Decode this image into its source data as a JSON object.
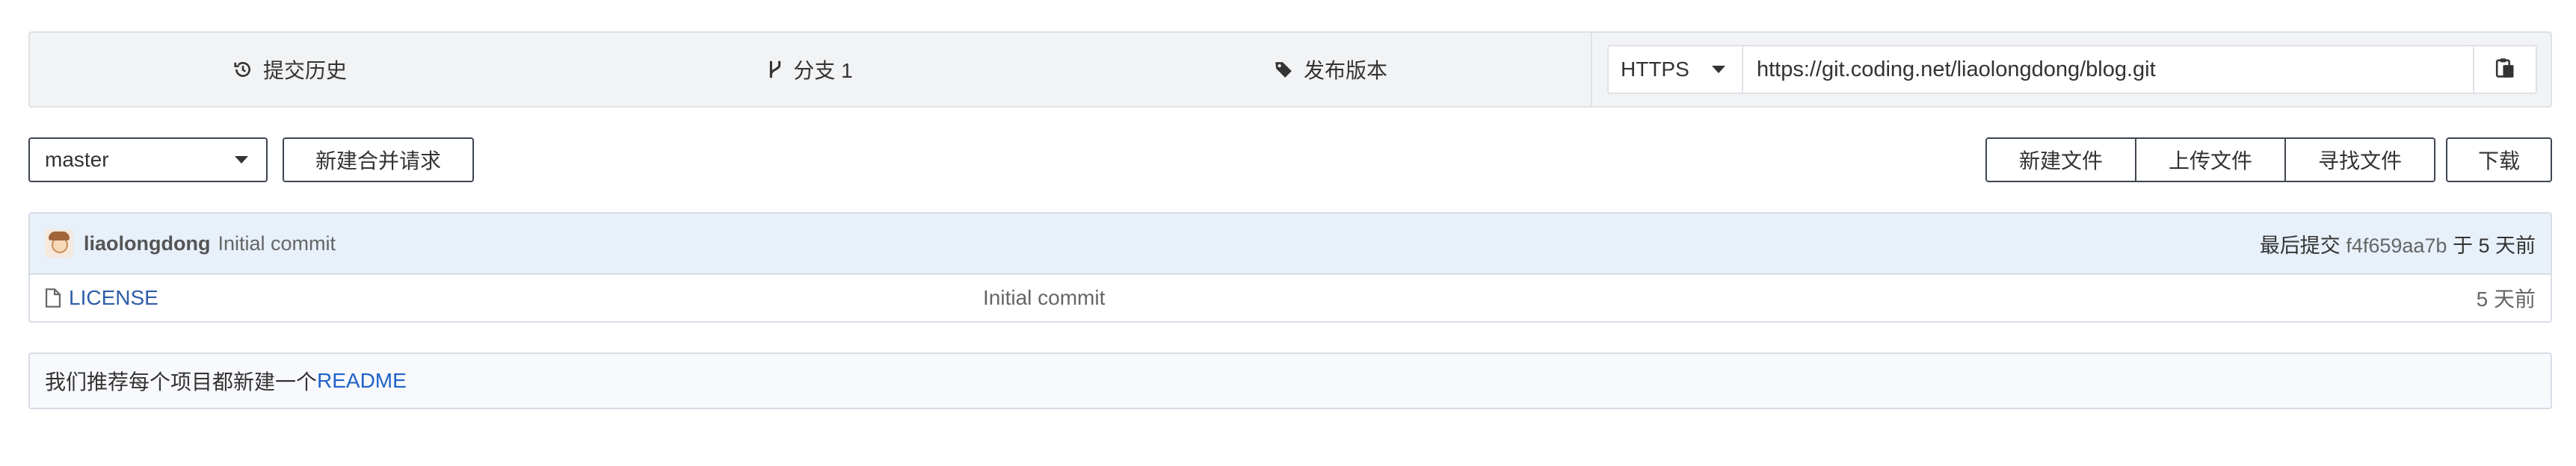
{
  "topbar": {
    "commits_label": "提交历史",
    "branches_label": "分支 1",
    "releases_label": "发布版本"
  },
  "clone": {
    "protocol": "HTTPS",
    "url": "https://git.coding.net/liaolongdong/blog.git"
  },
  "toolbar": {
    "branch": "master",
    "new_merge_request": "新建合并请求",
    "new_file": "新建文件",
    "upload_file": "上传文件",
    "find_file": "寻找文件",
    "download": "下载"
  },
  "last_commit": {
    "author": "liaolongdong",
    "message": "Initial commit",
    "prefix": "最后提交",
    "hash": "f4f659aa7b",
    "suffix": "于 5 天前"
  },
  "files": [
    {
      "name": "LICENSE",
      "message": "Initial commit",
      "time": "5 天前"
    }
  ],
  "readme_hint": {
    "text": "我们推荐每个项目都新建一个",
    "link": "README"
  },
  "colors": {
    "link": "#2f5ea8",
    "readme_link": "#1f63c9",
    "commit_row_bg": "#e8f0fa"
  }
}
